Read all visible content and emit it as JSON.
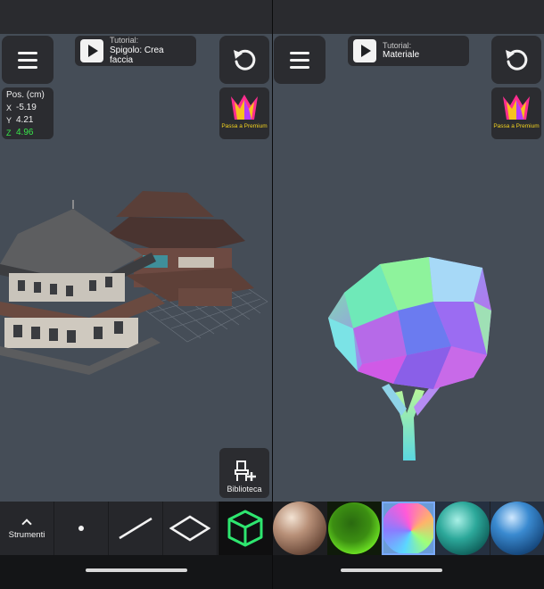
{
  "left_panel": {
    "tutorial": {
      "small": "Tutorial:",
      "title": "Spigolo: Crea faccia"
    },
    "position": {
      "title": "Pos. (cm)",
      "x_label": "X",
      "x": "-5.19",
      "y_label": "Y",
      "y": "4.21",
      "z_label": "Z",
      "z": "4.96"
    },
    "premium_label": "Passa a Premium",
    "library_label": "Biblioteca",
    "toolbar": {
      "strumenti_label": "Strumenti",
      "tools": [
        "point-icon",
        "edge-icon",
        "face-icon",
        "cube-icon"
      ]
    }
  },
  "right_panel": {
    "tutorial": {
      "small": "Tutorial:",
      "title": "Materiale"
    },
    "premium_label": "Passa a Premium",
    "materials": [
      "wood-bronze",
      "green-glow",
      "normal-rainbow",
      "teal-glass",
      "blue-glossy"
    ],
    "selected_material_index": 2
  },
  "colors": {
    "viewport": "#454d57",
    "panel_button": "#2b2c30",
    "z_axis": "#39e64a",
    "premium_text": "#f2d21f",
    "cube_tool": "#2ee66f"
  }
}
